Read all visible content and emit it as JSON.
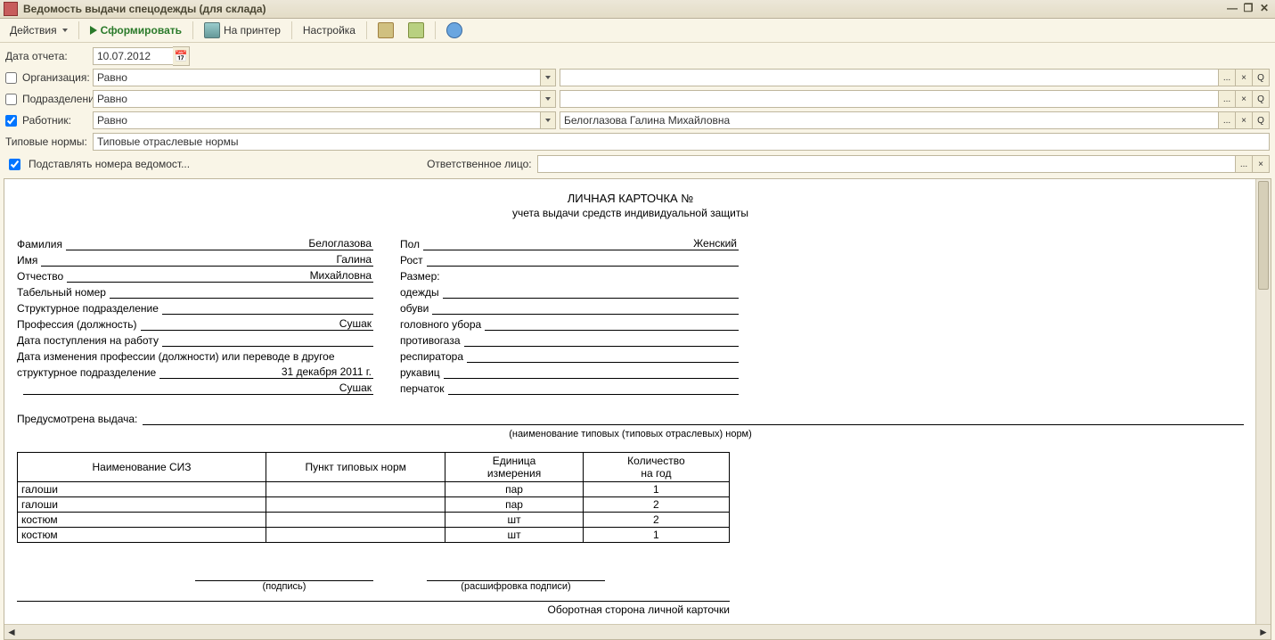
{
  "window": {
    "title": "Ведомость выдачи спецодежды (для склада)"
  },
  "toolbar": {
    "actions": "Действия",
    "form": "Сформировать",
    "print": "На принтер",
    "settings": "Настройка"
  },
  "filters": {
    "date_label": "Дата отчета:",
    "date_value": "10.07.2012",
    "org_label": "Организация:",
    "org_cond": "Равно",
    "org_value": "",
    "dep_label": "Подразделение:",
    "dep_cond": "Равно",
    "dep_value": "",
    "emp_label": "Работник:",
    "emp_cond": "Равно",
    "emp_value": "Белоглазова Галина Михайловна",
    "norm_label": "Типовые нормы:",
    "norm_value": "Типовые отраслевые нормы",
    "substitute_label": "Подставлять номера ведомост...",
    "responsible_label": "Ответственное лицо:",
    "responsible_value": ""
  },
  "report": {
    "title1": "ЛИЧНАЯ КАРТОЧКА №",
    "title2": "учета выдачи средств индивидуальной защиты",
    "left": {
      "last_name_l": "Фамилия",
      "last_name_v": "Белоглазова",
      "first_name_l": "Имя",
      "first_name_v": "Галина",
      "mid_name_l": "Отчество",
      "mid_name_v": "Михайловна",
      "tab_l": "Табельный номер",
      "tab_v": "",
      "dep_l": "Структурное подразделение",
      "dep_v": "",
      "prof_l": "Профессия (должность)",
      "prof_v": "Сушак",
      "hire_l": "Дата поступления на работу",
      "hire_v": "",
      "change_l1": "Дата изменения профессии (должности) или переводе в другое",
      "change_l2": "структурное подразделение",
      "change_v": "31 декабря 2011 г.",
      "change_v2": "Сушак"
    },
    "right": {
      "sex_l": "Пол",
      "sex_v": "Женский",
      "height_l": "Рост",
      "height_v": "",
      "size_l": "Размер:",
      "clothes_l": "одежды",
      "clothes_v": "",
      "shoes_l": "обуви",
      "shoes_v": "",
      "hat_l": "головного убора",
      "hat_v": "",
      "gasmask_l": "противогаза",
      "gasmask_v": "",
      "resp_l": "респиратора",
      "resp_v": "",
      "mitt_l": "рукавиц",
      "mitt_v": "",
      "glove_l": "перчаток",
      "glove_v": ""
    },
    "predusm_label": "Предусмотрена выдача:",
    "norm_note": "(наименование типовых (типовых отраслевых) норм)",
    "table": {
      "h1": "Наименование СИЗ",
      "h2": "Пункт типовых норм",
      "h3a": "Единица",
      "h3b": "измерения",
      "h4a": "Количество",
      "h4b": "на год",
      "rows": [
        {
          "name": "галоши",
          "point": "",
          "unit": "пар",
          "qty": "1"
        },
        {
          "name": "галоши",
          "point": "",
          "unit": "пар",
          "qty": "2"
        },
        {
          "name": "костюм",
          "point": "",
          "unit": "шт",
          "qty": "2"
        },
        {
          "name": "костюм",
          "point": "",
          "unit": "шт",
          "qty": "1"
        }
      ]
    },
    "sign_label": "(подпись)",
    "sign_decode": "(расшифровка подписи)",
    "back_title": "Оборотная сторона личной карточки"
  }
}
